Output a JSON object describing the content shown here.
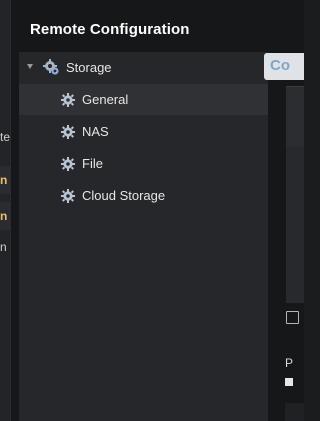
{
  "background": {
    "fragments": [
      "te",
      "n",
      "n",
      "n"
    ]
  },
  "dialog": {
    "title": "Remote Configuration"
  },
  "tree": {
    "root": {
      "label": "Storage",
      "icon": "gear-icon",
      "expanded": true
    },
    "children": [
      {
        "label": "General",
        "icon": "gear-icon",
        "selected": true
      },
      {
        "label": "NAS",
        "icon": "gear-icon",
        "selected": false
      },
      {
        "label": "File",
        "icon": "gear-icon",
        "selected": false
      },
      {
        "label": "Cloud Storage",
        "icon": "gear-icon",
        "selected": false
      }
    ]
  },
  "right_panel": {
    "tab_label": "Co",
    "field_label": "P"
  },
  "colors": {
    "dialog_bg": "#161719",
    "tree_bg": "#26272a",
    "selected_row": "#303135",
    "tab_text": "#7fa6c8"
  }
}
